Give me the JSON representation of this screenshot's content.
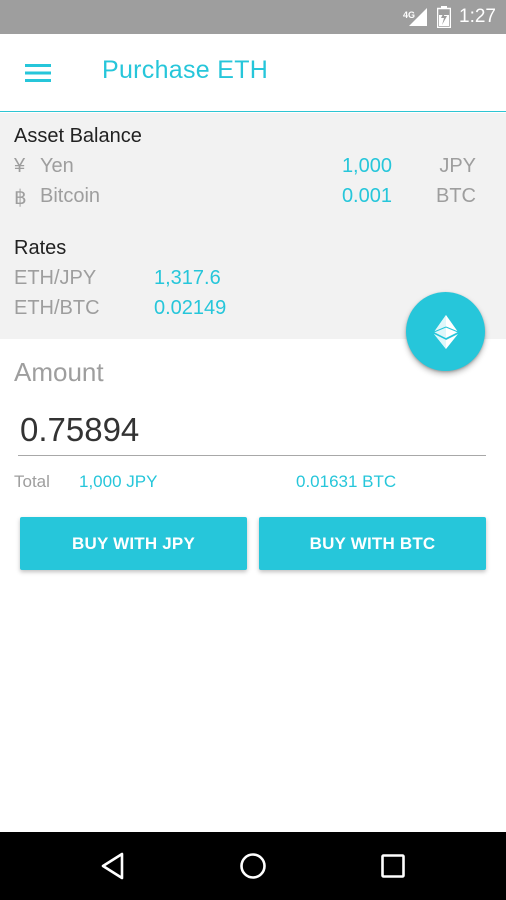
{
  "status_bar": {
    "network": "4G",
    "time": "1:27",
    "icons": [
      "signal-icon",
      "battery-icon"
    ]
  },
  "app_bar": {
    "title": "Purchase ETH",
    "menu_icon": "hamburger-menu-icon"
  },
  "asset_balance": {
    "heading": "Asset Balance",
    "items": [
      {
        "icon": "¥",
        "label": "Yen",
        "value": "1,000",
        "unit": "JPY"
      },
      {
        "icon": "฿",
        "label": "Bitcoin",
        "value": "0.001",
        "unit": "BTC"
      }
    ]
  },
  "rates": {
    "heading": "Rates",
    "items": [
      {
        "label": "ETH/JPY",
        "value": "1,317.6"
      },
      {
        "label": "ETH/BTC",
        "value": "0.02149"
      }
    ]
  },
  "fab": {
    "icon": "ethereum-icon"
  },
  "amount": {
    "label": "Amount",
    "value": "0.75894"
  },
  "total": {
    "label": "Total",
    "jpy": "1,000 JPY",
    "btc": "0.01631 BTC"
  },
  "buttons": {
    "buy_jpy": "BUY WITH JPY",
    "buy_btc": "BUY WITH BTC"
  },
  "nav_bar": {
    "icons": [
      "back-icon",
      "home-icon",
      "recent-apps-icon"
    ]
  },
  "colors": {
    "accent": "#26c6da",
    "status_bar": "#9e9e9e",
    "panel_bg": "#f2f2f2",
    "nav_bar": "#000000"
  }
}
